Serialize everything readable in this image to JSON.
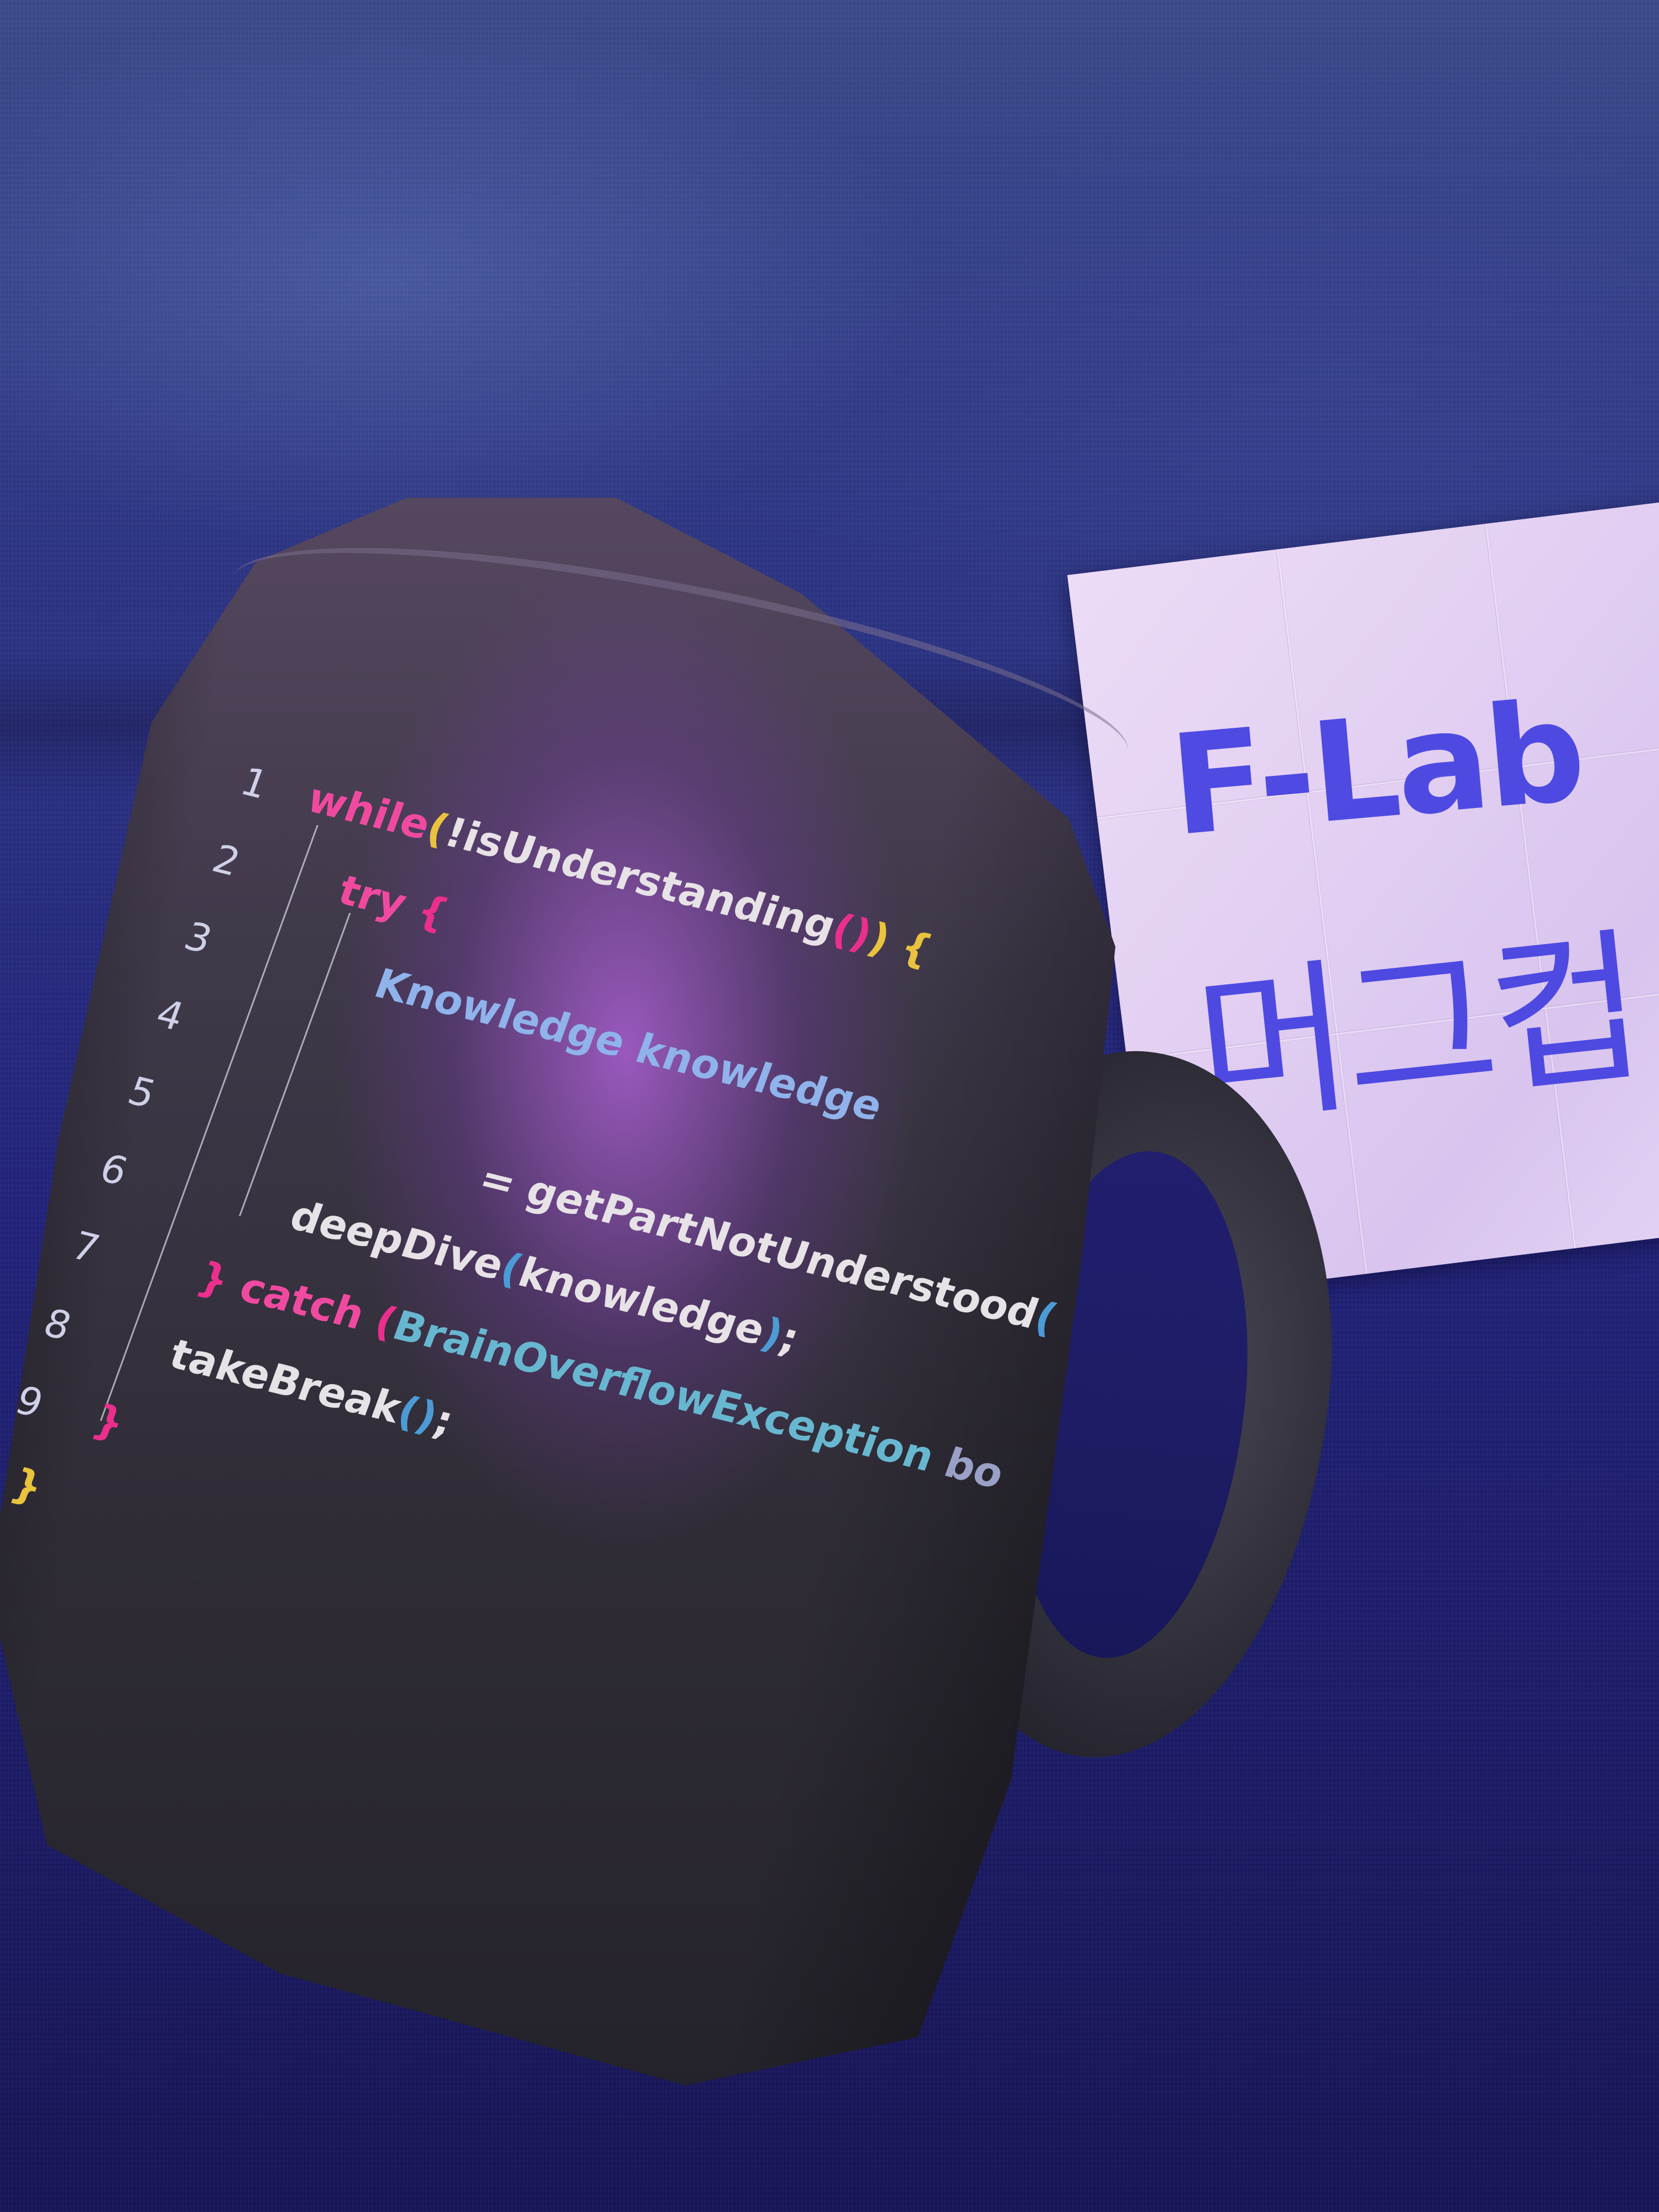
{
  "image": {
    "subject": "black coffee mug with printed code, folded paper note behind it"
  },
  "note": {
    "line1": "F-Lab",
    "line2": "머그컵",
    "ink_color": "#3f3ce0"
  },
  "code": {
    "lines": [
      {
        "number": "1",
        "text": "while(!isUnderstanding()) {"
      },
      {
        "number": "2",
        "text": "try {"
      },
      {
        "number": "3",
        "text": "Knowledge knowledge"
      },
      {
        "number": "4",
        "text": ""
      },
      {
        "number": "5",
        "text": "= getPartNotUnderstood("
      },
      {
        "number": "6",
        "text": "deepDive(knowledge);"
      },
      {
        "number": "7",
        "text": "} catch (BrainOverflowException bo"
      },
      {
        "number": "8",
        "text": "takeBreak();"
      },
      {
        "number": "9",
        "text": "}"
      }
    ],
    "closing": "}",
    "colors": {
      "keyword": "#f04aa0",
      "brace": "#e9c23e",
      "type": "#8fb3ea",
      "plain": "#e7e2e6",
      "paren": "#4c9bd6"
    }
  }
}
